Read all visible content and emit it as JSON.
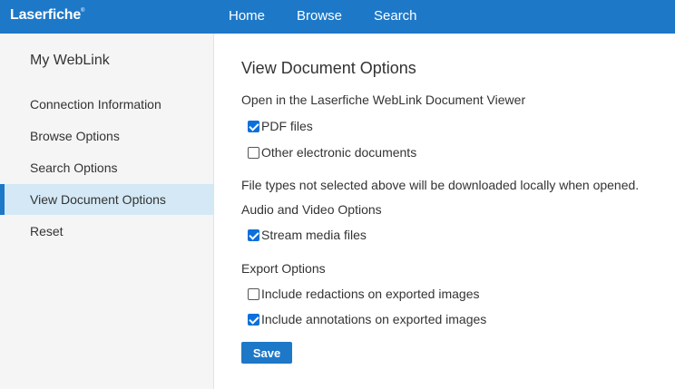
{
  "header": {
    "logo": "Laserfiche",
    "logo_mark": "®",
    "nav": [
      "Home",
      "Browse",
      "Search"
    ]
  },
  "sidebar": {
    "title": "My WebLink",
    "items": [
      {
        "label": "Connection Information",
        "active": false
      },
      {
        "label": "Browse Options",
        "active": false
      },
      {
        "label": "Search Options",
        "active": false
      },
      {
        "label": "View Document Options",
        "active": true
      },
      {
        "label": "Reset",
        "active": false
      }
    ]
  },
  "main": {
    "title": "View Document Options",
    "viewer_heading": "Open in the Laserfiche WebLink Document Viewer",
    "viewer_options": [
      {
        "label": "PDF files",
        "checked": true
      },
      {
        "label": "Other electronic documents",
        "checked": false
      }
    ],
    "note": "File types not selected above will be downloaded locally when opened.",
    "av_heading": "Audio and Video Options",
    "av_options": [
      {
        "label": "Stream media files",
        "checked": true
      }
    ],
    "export_heading": "Export Options",
    "export_options": [
      {
        "label": "Include redactions on exported images",
        "checked": false
      },
      {
        "label": "Include annotations on exported images",
        "checked": true
      }
    ],
    "save_label": "Save"
  },
  "colors": {
    "accent": "#1e78c8",
    "sidebar_bg": "#f5f5f5",
    "active_item_bg": "#d4e9f5",
    "checkbox_checked": "#0b6fdc"
  }
}
